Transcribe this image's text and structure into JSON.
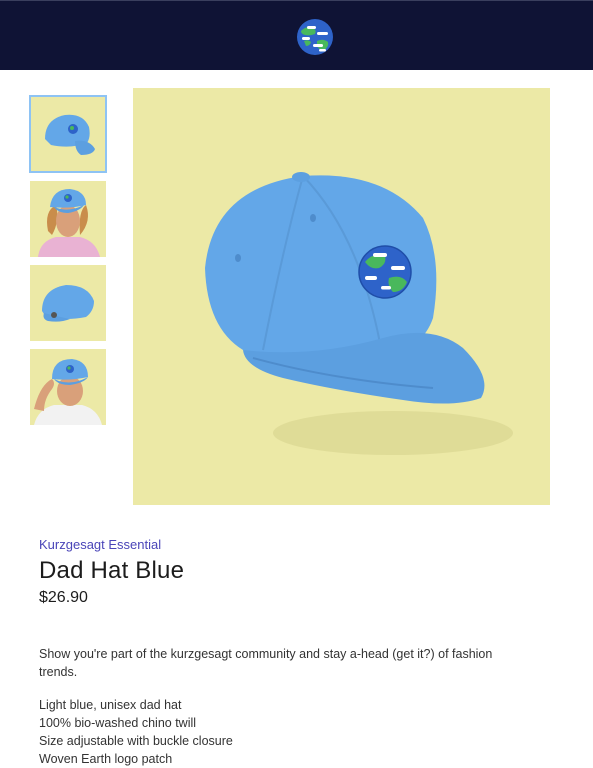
{
  "header": {
    "logo_icon": "earth-logo-icon",
    "background": "#0f1335"
  },
  "gallery": {
    "thumbnails": [
      {
        "icon": "cap-thumbnail-icon",
        "selected": true
      },
      {
        "icon": "person-wearing-cap-thumbnail-icon",
        "selected": false
      },
      {
        "icon": "cap-back-thumbnail-icon",
        "selected": false
      },
      {
        "icon": "person-touching-cap-thumbnail-icon",
        "selected": false
      }
    ],
    "main_image": {
      "icon": "blue-cap-icon",
      "background": "#ece9a6"
    }
  },
  "product": {
    "collection": "Kurzgesagt Essential",
    "title": "Dad Hat Blue",
    "price": "$26.90",
    "description": "Show you're part of the kurzgesagt community and stay a-head (get it?) of fashion trends.",
    "features": [
      "Light blue, unisex dad hat",
      "100% bio-washed chino twill",
      "Size adjustable with buckle closure",
      "Woven Earth logo patch"
    ]
  },
  "colors": {
    "accent": "#4a45b8",
    "cap_blue": "#63a7e8",
    "selected_border": "#8ec3f4"
  }
}
